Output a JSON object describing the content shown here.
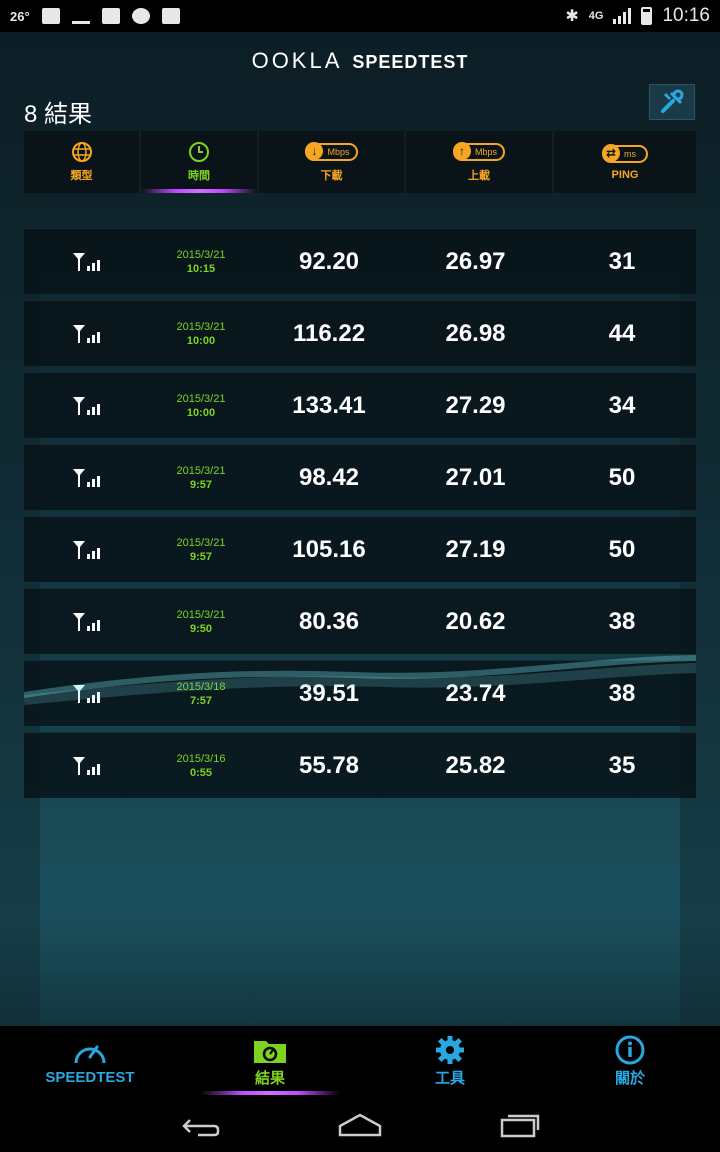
{
  "status_bar": {
    "temperature": "26°",
    "network": "4G",
    "time": "10:16"
  },
  "header": {
    "brand_ookla": "OOKLA",
    "brand_speedtest": "SPEEDTEST",
    "results_count": "8 結果"
  },
  "columns": {
    "type": "類型",
    "time": "時間",
    "download": "下載",
    "upload": "上載",
    "ping": "PING",
    "mbps": "Mbps",
    "ms": "ms"
  },
  "results": [
    {
      "date": "2015/3/21",
      "time": "10:15",
      "download": "92.20",
      "upload": "26.97",
      "ping": "31"
    },
    {
      "date": "2015/3/21",
      "time": "10:00",
      "download": "116.22",
      "upload": "26.98",
      "ping": "44"
    },
    {
      "date": "2015/3/21",
      "time": "10:00",
      "download": "133.41",
      "upload": "27.29",
      "ping": "34"
    },
    {
      "date": "2015/3/21",
      "time": "9:57",
      "download": "98.42",
      "upload": "27.01",
      "ping": "50"
    },
    {
      "date": "2015/3/21",
      "time": "9:57",
      "download": "105.16",
      "upload": "27.19",
      "ping": "50"
    },
    {
      "date": "2015/3/21",
      "time": "9:50",
      "download": "80.36",
      "upload": "20.62",
      "ping": "38"
    },
    {
      "date": "2015/3/18",
      "time": "7:57",
      "download": "39.51",
      "upload": "23.74",
      "ping": "38"
    },
    {
      "date": "2015/3/16",
      "time": "0:55",
      "download": "55.78",
      "upload": "25.82",
      "ping": "35"
    }
  ],
  "bottom_nav": {
    "speedtest": "SPEEDTEST",
    "results": "結果",
    "tools": "工具",
    "about": "關於"
  },
  "colors": {
    "accent_orange": "#f5a623",
    "accent_green": "#7ed321",
    "accent_blue": "#29a7e1",
    "active_purple": "#c04bff"
  }
}
